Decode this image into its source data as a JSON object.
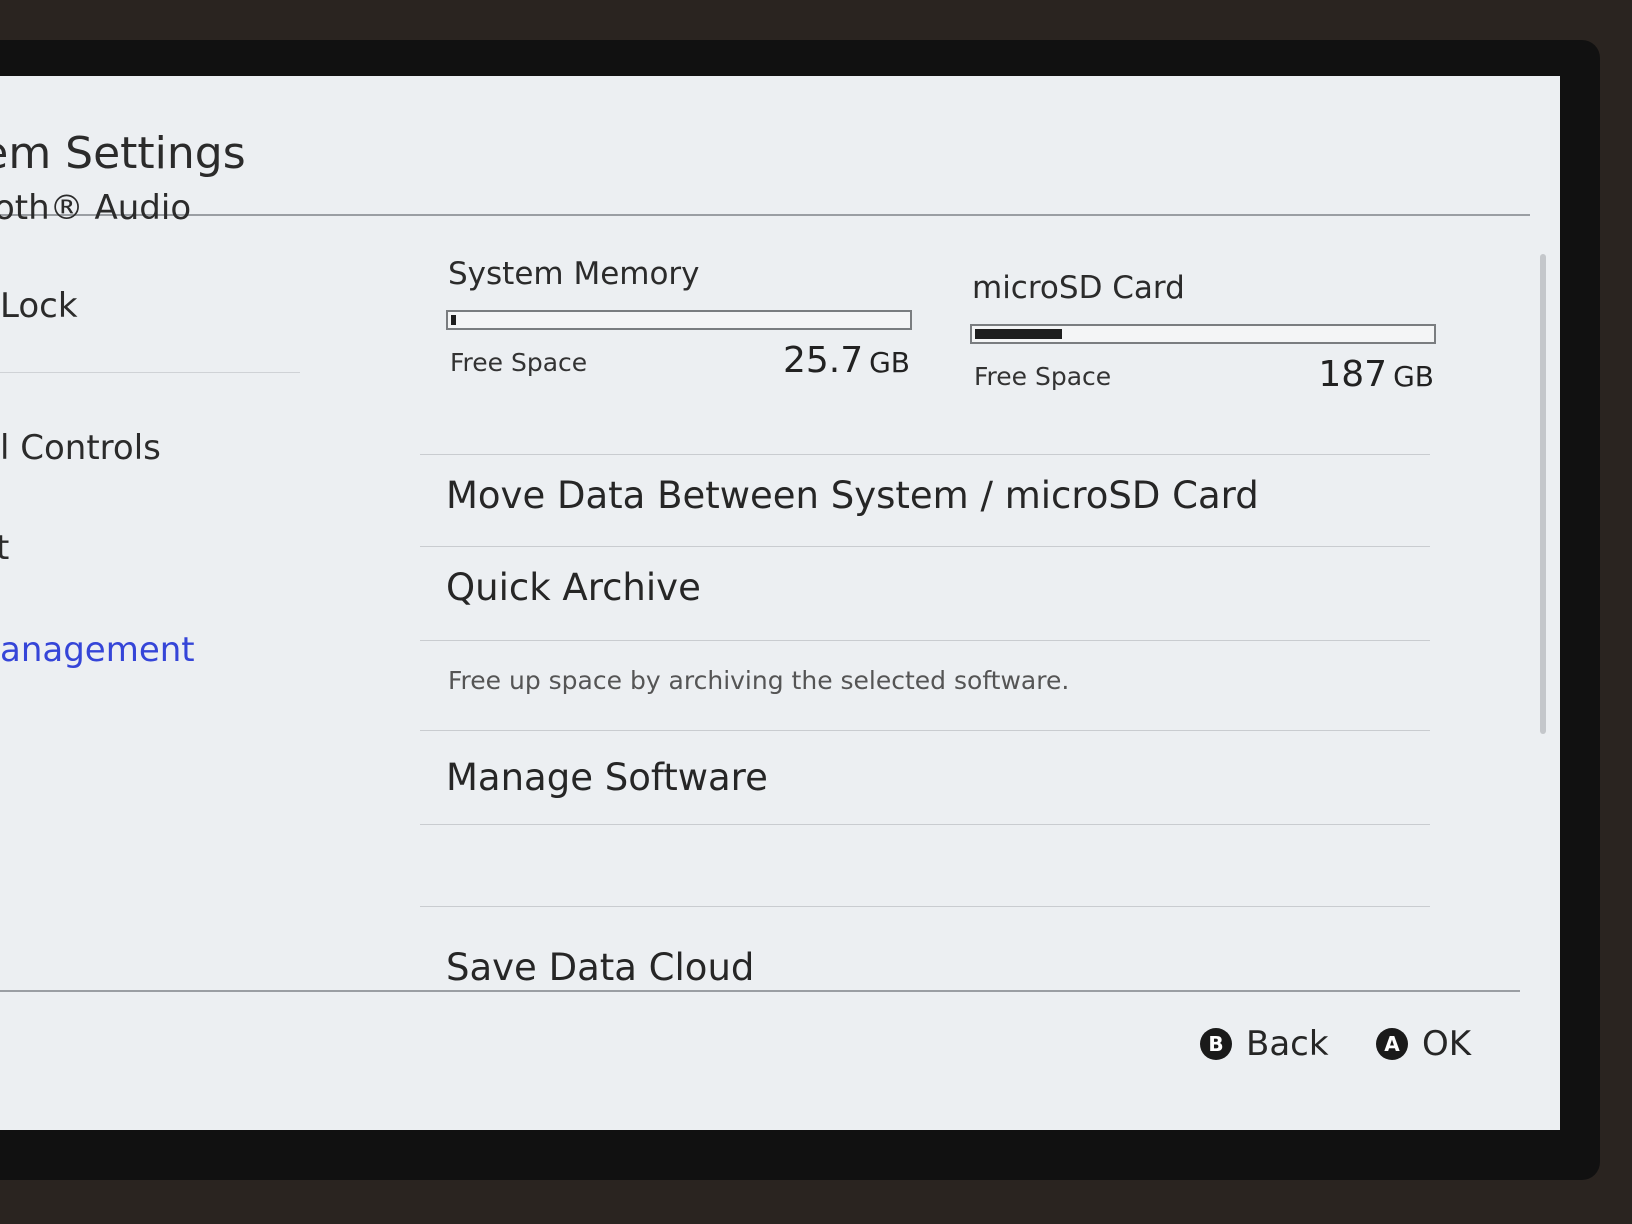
{
  "header": {
    "title": "tem Settings"
  },
  "sidebar": {
    "items": [
      {
        "label": "oth® Audio"
      },
      {
        "label": "Lock"
      },
      {
        "label": "l Controls"
      },
      {
        "label": "t"
      },
      {
        "label": "anagement",
        "selected": true
      }
    ]
  },
  "storage": {
    "system": {
      "label": "System Memory",
      "free_label": "Free Space",
      "free_value": "25.7",
      "free_unit": "GB",
      "used_fraction": 0.01
    },
    "sd": {
      "label": "microSD Card",
      "free_label": "Free Space",
      "free_value": "187",
      "free_unit": "GB",
      "used_fraction": 0.19
    }
  },
  "menu": {
    "move_data": "Move Data Between System / microSD Card",
    "quick_archive": "Quick Archive",
    "quick_archive_desc": "Free up space by archiving the selected software.",
    "manage_software": "Manage Software",
    "save_data_cloud": "Save Data Cloud"
  },
  "footer": {
    "back": {
      "glyph": "B",
      "label": "Back"
    },
    "ok": {
      "glyph": "A",
      "label": "OK"
    }
  },
  "colors": {
    "accent": "#3545d8",
    "background": "#eceff2",
    "text": "#262626"
  }
}
